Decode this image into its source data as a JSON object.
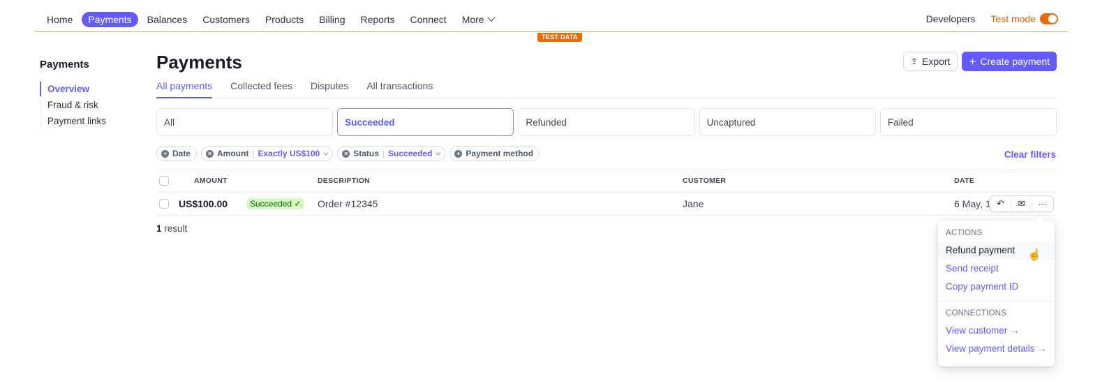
{
  "nav": {
    "items": [
      {
        "label": "Home",
        "active": false
      },
      {
        "label": "Payments",
        "active": true
      },
      {
        "label": "Balances",
        "active": false
      },
      {
        "label": "Customers",
        "active": false
      },
      {
        "label": "Products",
        "active": false
      },
      {
        "label": "Billing",
        "active": false
      },
      {
        "label": "Reports",
        "active": false
      },
      {
        "label": "Connect",
        "active": false
      }
    ],
    "more_label": "More",
    "developers_label": "Developers",
    "test_mode_label": "Test mode",
    "test_mode_on": true,
    "test_data_badge": "TEST DATA"
  },
  "sidebar": {
    "title": "Payments",
    "items": [
      {
        "label": "Overview",
        "active": true
      },
      {
        "label": "Fraud & risk",
        "active": false
      },
      {
        "label": "Payment links",
        "active": false
      }
    ]
  },
  "main": {
    "title": "Payments",
    "export_label": "Export",
    "create_label": "Create payment",
    "tabs": [
      {
        "label": "All payments",
        "active": true
      },
      {
        "label": "Collected fees",
        "active": false
      },
      {
        "label": "Disputes",
        "active": false
      },
      {
        "label": "All transactions",
        "active": false
      }
    ],
    "status_cards": [
      {
        "label": "All",
        "active": false
      },
      {
        "label": "Succeeded",
        "active": true
      },
      {
        "label": "Refunded",
        "active": false
      },
      {
        "label": "Uncaptured",
        "active": false
      },
      {
        "label": "Failed",
        "active": false
      }
    ],
    "filters": [
      {
        "label": "Date",
        "value": null,
        "applied": false
      },
      {
        "label": "Amount",
        "value": "Exactly US$100",
        "applied": true
      },
      {
        "label": "Status",
        "value": "Succeeded",
        "applied": true
      },
      {
        "label": "Payment method",
        "value": null,
        "applied": false
      }
    ],
    "clear_filters_label": "Clear filters",
    "table": {
      "columns": [
        "AMOUNT",
        "DESCRIPTION",
        "CUSTOMER",
        "DATE"
      ],
      "rows": [
        {
          "amount": "US$100.00",
          "status": "Succeeded ✓",
          "description": "Order #12345",
          "customer": "Jane",
          "date": "6 May, 12"
        }
      ]
    },
    "result_count": "1",
    "result_label": " result"
  },
  "menu": {
    "actions_header": "ACTIONS",
    "actions": [
      "Refund payment",
      "Send receipt",
      "Copy payment ID"
    ],
    "connections_header": "CONNECTIONS",
    "connections": [
      "View customer →",
      "View payment details →"
    ]
  },
  "colors": {
    "accent": "#635bff",
    "test_mode": "#ea6b09",
    "success_bg": "#d7f7c2",
    "success_text": "#05690d"
  }
}
